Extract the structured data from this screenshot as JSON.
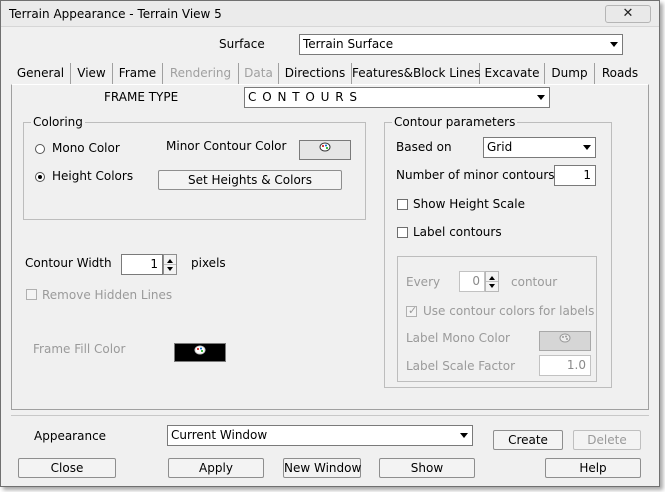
{
  "window": {
    "title": "Terrain Appearance - Terrain View 5",
    "close_glyph": "✕"
  },
  "surface": {
    "label": "Surface",
    "value": "Terrain Surface"
  },
  "tabs": [
    {
      "label": "General",
      "state": "normal"
    },
    {
      "label": "View",
      "state": "normal"
    },
    {
      "label": "Frame",
      "state": "active"
    },
    {
      "label": "Rendering",
      "state": "disabled"
    },
    {
      "label": "Data",
      "state": "disabled"
    },
    {
      "label": "Directions",
      "state": "normal"
    },
    {
      "label": "Features&Block Lines",
      "state": "normal"
    },
    {
      "label": "Excavate",
      "state": "normal"
    },
    {
      "label": "Dump",
      "state": "normal"
    },
    {
      "label": "Roads",
      "state": "normal"
    }
  ],
  "frame_type": {
    "label": "FRAME TYPE",
    "value": "C O N T O U R S"
  },
  "coloring": {
    "group_label": "Coloring",
    "mono_label": "Mono Color",
    "height_label": "Height Colors",
    "selected": "Height Colors",
    "minor_contour_color_label": "Minor Contour Color",
    "set_heights_button": "Set Heights & Colors"
  },
  "contour_width": {
    "label": "Contour Width",
    "value": "1",
    "unit": "pixels"
  },
  "remove_hidden_lines": {
    "label": "Remove Hidden Lines",
    "checked": false,
    "enabled": false
  },
  "frame_fill": {
    "label": "Frame Fill Color",
    "color": "#000000"
  },
  "contour_params": {
    "group_label": "Contour parameters",
    "based_on_label": "Based on",
    "based_on_value": "Grid",
    "minor_count_label": "Number of minor contours",
    "minor_count_value": "1",
    "show_height_scale_label": "Show Height Scale",
    "label_contours_label": "Label contours",
    "every_label": "Every",
    "every_value": "0",
    "every_unit": "contour",
    "use_contour_colors_label": "Use contour colors for labels",
    "label_mono_color_label": "Label Mono Color",
    "label_scale_factor_label": "Label Scale Factor",
    "label_scale_factor_value": "1.0"
  },
  "appearance": {
    "label": "Appearance",
    "value": "Current Window"
  },
  "buttons": {
    "create": "Create",
    "delete": "Delete",
    "close": "Close",
    "apply": "Apply",
    "new_window": "New Window",
    "show": "Show",
    "help": "Help"
  }
}
